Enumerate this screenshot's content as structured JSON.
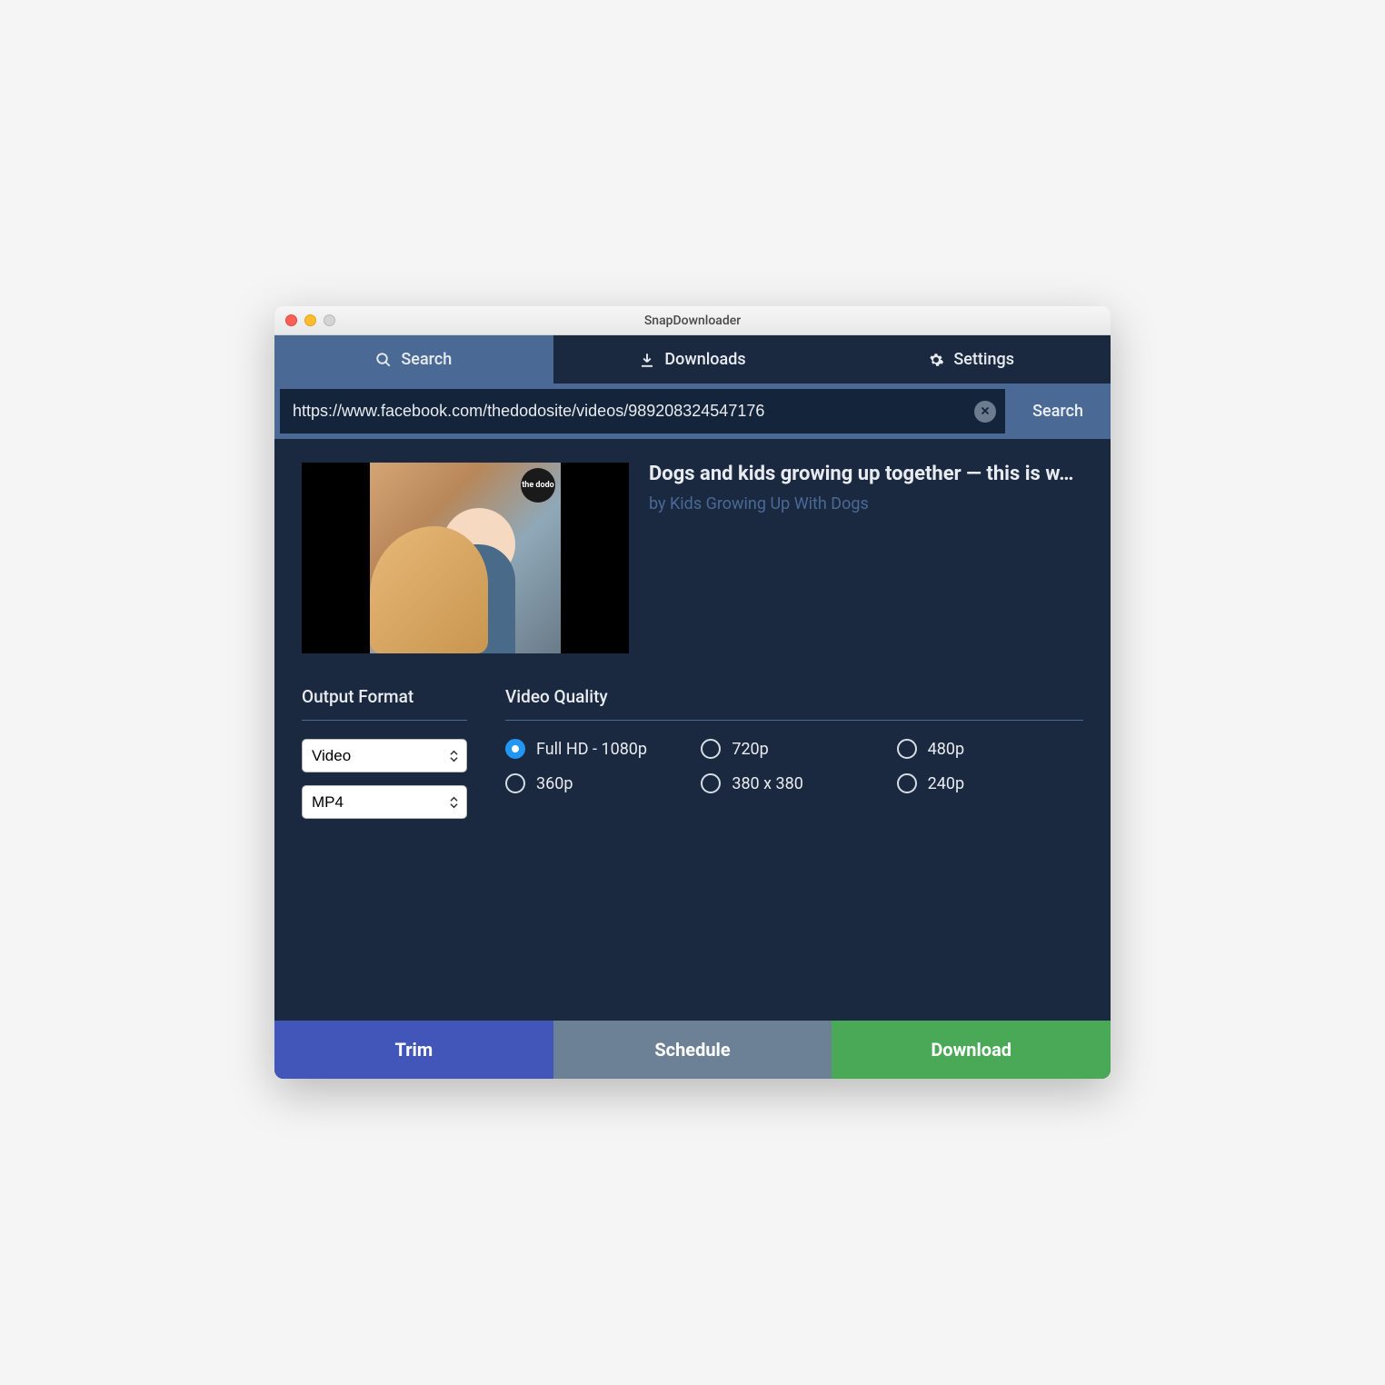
{
  "window": {
    "title": "SnapDownloader"
  },
  "tabs": {
    "search": "Search",
    "downloads": "Downloads",
    "settings": "Settings"
  },
  "search": {
    "url": "https://www.facebook.com/thedodosite/videos/989208324547176",
    "button": "Search"
  },
  "video": {
    "title": "Dogs and kids growing up together — this is w…",
    "author_prefix": "by ",
    "author": "Kids Growing Up With Dogs",
    "badge": "the dodo"
  },
  "format": {
    "header": "Output Format",
    "type_value": "Video",
    "container_value": "MP4"
  },
  "quality": {
    "header": "Video Quality",
    "options": [
      {
        "label": "Full HD - 1080p",
        "selected": true
      },
      {
        "label": "720p",
        "selected": false
      },
      {
        "label": "480p",
        "selected": false
      },
      {
        "label": "360p",
        "selected": false
      },
      {
        "label": "380 x 380",
        "selected": false
      },
      {
        "label": "240p",
        "selected": false
      }
    ]
  },
  "actions": {
    "trim": "Trim",
    "schedule": "Schedule",
    "download": "Download"
  }
}
